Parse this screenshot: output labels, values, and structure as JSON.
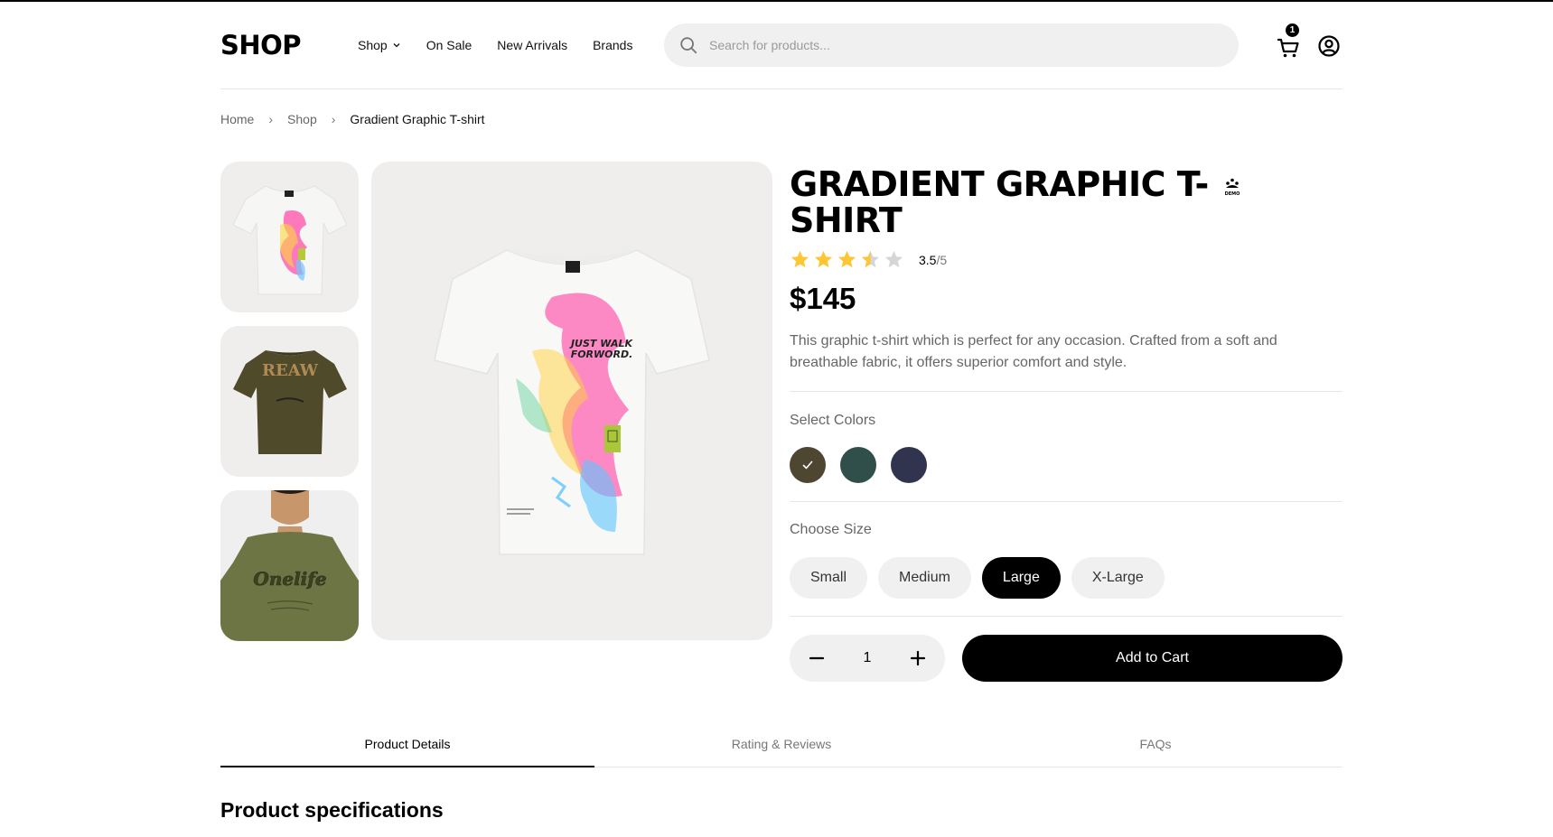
{
  "header": {
    "logo": "SHOP",
    "nav": [
      {
        "label": "Shop",
        "has_dropdown": true
      },
      {
        "label": "On Sale"
      },
      {
        "label": "New Arrivals"
      },
      {
        "label": "Brands"
      }
    ],
    "search_placeholder": "Search for products...",
    "cart_count": "1"
  },
  "breadcrumb": {
    "items": [
      "Home",
      "Shop"
    ],
    "current": "Gradient Graphic T-shirt"
  },
  "gallery": {
    "thumbnails": [
      "white-gradient-tshirt",
      "olive-graphic-tshirt",
      "olive-tshirt-model"
    ],
    "main_image": "white-gradient-tshirt"
  },
  "product": {
    "title": "GRADIENT GRAPHIC T-SHIRT",
    "rating_value": 3.5,
    "rating_text": "3.5",
    "rating_max": "/5",
    "price": "$145",
    "description": "This graphic t-shirt which is perfect for any occasion. Crafted from a soft and breathable fabric, it offers superior comfort and style.",
    "colors_label": "Select Colors",
    "colors": [
      {
        "hex": "#4f4631",
        "selected": true
      },
      {
        "hex": "#314f4a",
        "selected": false
      },
      {
        "hex": "#31344f",
        "selected": false
      }
    ],
    "size_label": "Choose Size",
    "sizes": [
      {
        "label": "Small",
        "selected": false
      },
      {
        "label": "Medium",
        "selected": false
      },
      {
        "label": "Large",
        "selected": true
      },
      {
        "label": "X-Large",
        "selected": false
      }
    ],
    "quantity": "1",
    "add_to_cart": "Add to Cart"
  },
  "tabs": [
    {
      "label": "Product Details",
      "active": true
    },
    {
      "label": "Rating & Reviews",
      "active": false
    },
    {
      "label": "FAQs",
      "active": false
    }
  ],
  "details": {
    "heading": "Product specifications"
  },
  "colors": {
    "accent": "#000000",
    "star": "#ffc633",
    "star_empty": "#d6d6d6",
    "image_bg": "#f0eeed",
    "muted_text": "#666666"
  }
}
